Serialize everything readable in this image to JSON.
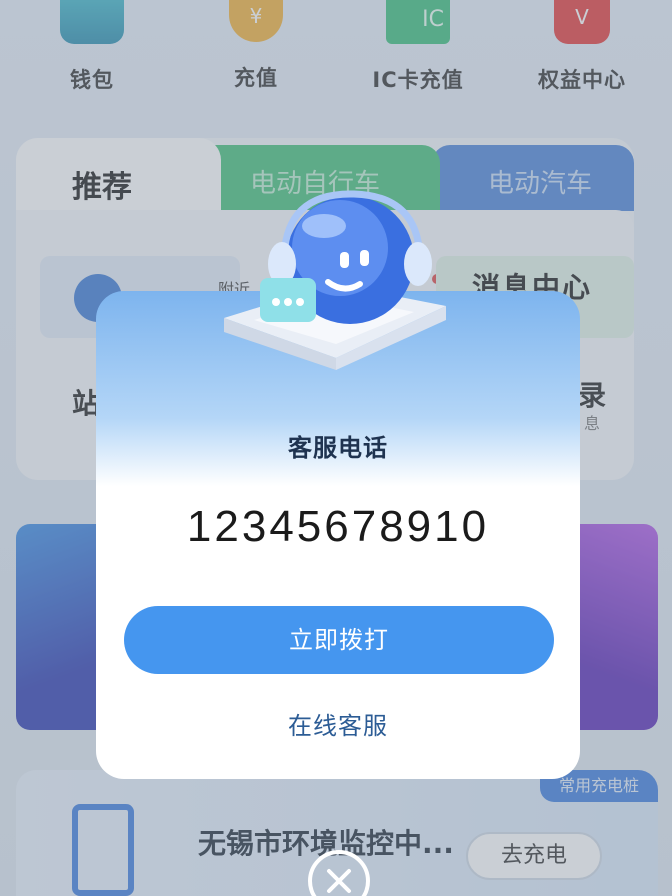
{
  "top_icons": [
    {
      "label": "钱包",
      "icon": "wallet-icon"
    },
    {
      "label": "充值",
      "icon": "yen-coin-icon",
      "glyph": "¥"
    },
    {
      "label": "IC卡充值",
      "icon": "ic-card-icon",
      "glyph": "IC"
    },
    {
      "label": "权益中心",
      "icon": "rights-v-icon",
      "glyph": "V"
    }
  ],
  "tabs": {
    "recommend": "推荐",
    "e_bike": "电动自行车",
    "e_car": "电动汽车"
  },
  "home": {
    "nearby": "附近",
    "message_center": "消息中心",
    "station_partial": "站",
    "records_partial": "录",
    "info_partial": "息"
  },
  "charger_card": {
    "tag": "常用充电桩",
    "station_name": "无锡市环境监控中...",
    "go_charge": "去充电"
  },
  "modal": {
    "title": "客服电话",
    "phone": "12345678910",
    "call_button": "立即拨打",
    "online_service": "在线客服"
  },
  "colors": {
    "call_button": "#4596ef",
    "bike_tab": "#46c17b",
    "car_tab": "#4e86d9"
  }
}
